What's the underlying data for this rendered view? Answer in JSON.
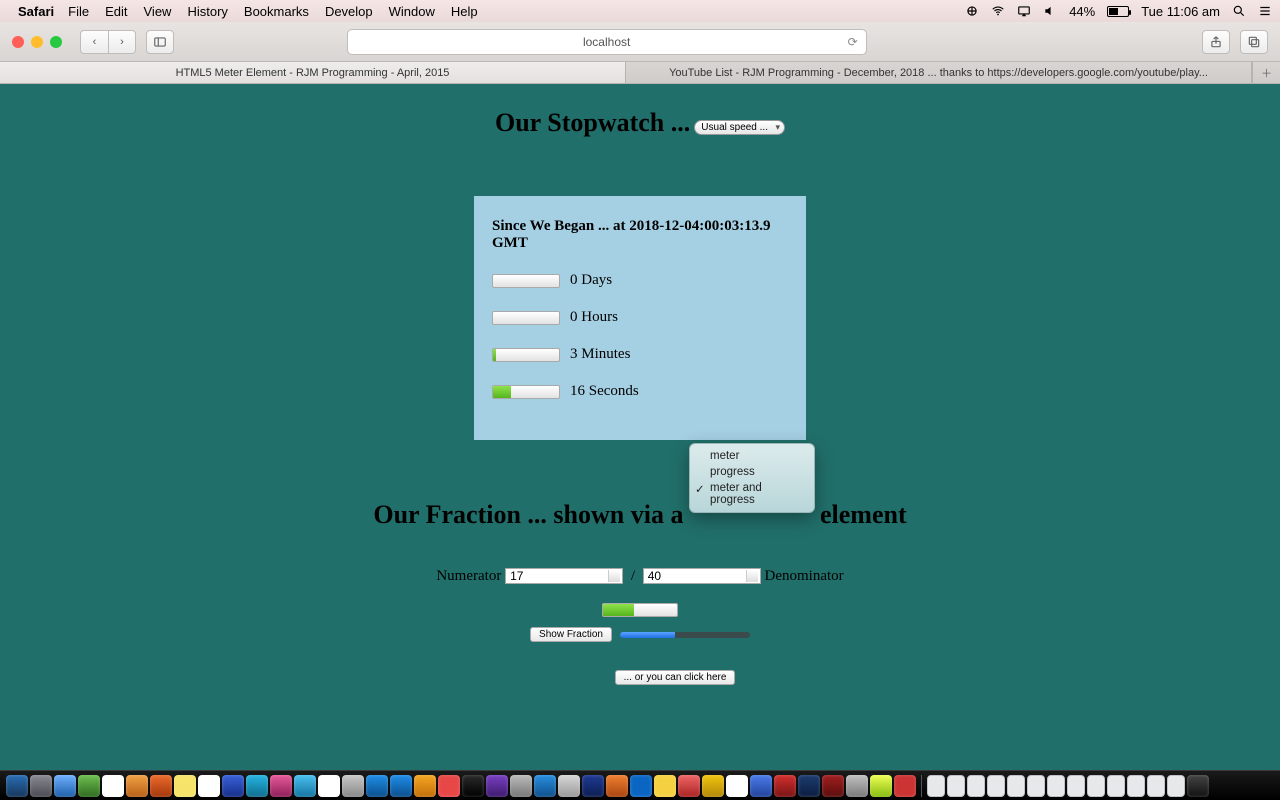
{
  "menubar": {
    "app": "Safari",
    "items": [
      "File",
      "Edit",
      "View",
      "History",
      "Bookmarks",
      "Develop",
      "Window",
      "Help"
    ],
    "battery": "44%",
    "clock": "Tue 11:06 am"
  },
  "safari": {
    "url": "localhost",
    "tabs": [
      "HTML5 Meter Element - RJM Programming - April, 2015",
      "YouTube List - RJM Programming - December, 2018 ... thanks to https://developers.google.com/youtube/play..."
    ],
    "active_tab": 0
  },
  "page": {
    "stopwatch": {
      "title": "Our Stopwatch ...",
      "speed_select": "Usual speed ...",
      "since_label": "Since We Began ... at 2018-12-04:00:03:13.9 GMT",
      "rows": [
        {
          "value": 0,
          "unit": "Days",
          "ratio": 0.0
        },
        {
          "value": 0,
          "unit": "Hours",
          "ratio": 0.0
        },
        {
          "value": 3,
          "unit": "Minutes",
          "ratio": 0.05
        },
        {
          "value": 16,
          "unit": "Seconds",
          "ratio": 0.27
        }
      ]
    },
    "fraction": {
      "title_pre": "Our Fraction ... shown via a",
      "title_post": "element",
      "dropdown_options": [
        "meter",
        "progress",
        "meter and progress"
      ],
      "dropdown_selected": "meter and progress",
      "numerator_label": "Numerator",
      "denominator_label": "Denominator",
      "numerator": "17",
      "denominator": "40",
      "show_button": "Show Fraction",
      "click_here": "... or you can click here",
      "fraction_ratio": 0.425
    }
  }
}
